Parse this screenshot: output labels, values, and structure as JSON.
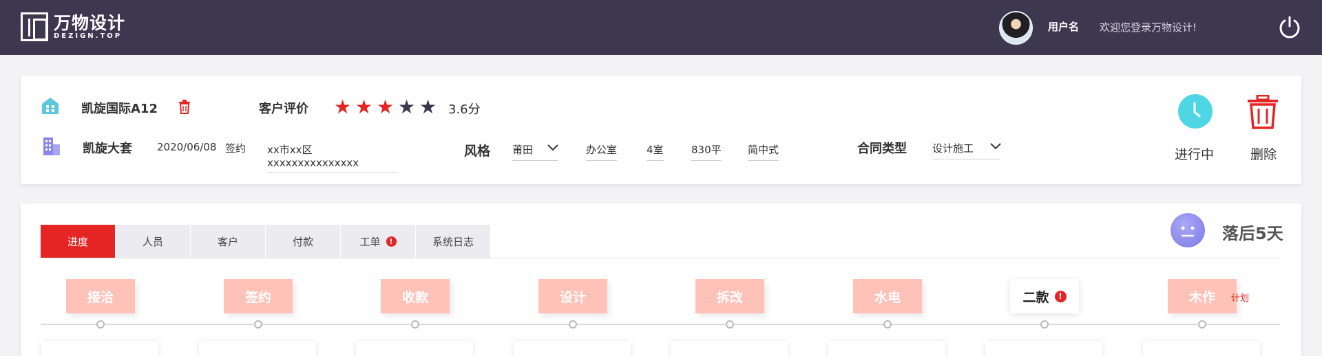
{
  "header": {
    "logo_cn": "万物设计",
    "logo_en": "DEZIGN.TOP",
    "username": "用户名",
    "welcome": "欢迎您登录万物设计!",
    "power_icon": "power-icon"
  },
  "project": {
    "name": "凯旋国际A12",
    "rating_label": "客户评价",
    "rating_value": 3.6,
    "rating_text": "3.6分",
    "rating_stars_filled": 3,
    "rating_stars_total": 5,
    "suite_name": "凯旋大套",
    "date": "2020/06/08",
    "sign_label": "签约",
    "address": "xx市xx区xxxxxxxxxxxxxxx",
    "style_label": "风格",
    "style_select": "莆田",
    "room_type": "办公室",
    "rooms": "4室",
    "area": "830平",
    "decor_style": "简中式",
    "contract_label": "合同类型",
    "contract_select": "设计施工",
    "status_label": "进行中",
    "delete_label": "删除"
  },
  "tabs": [
    {
      "label": "进度",
      "active": true
    },
    {
      "label": "人员",
      "active": false
    },
    {
      "label": "客户",
      "active": false
    },
    {
      "label": "付款",
      "active": false
    },
    {
      "label": "工单",
      "active": false,
      "alert": true
    },
    {
      "label": "系统日志",
      "active": false
    }
  ],
  "progress": {
    "behind_text": "落后5天",
    "plan_tag": "计划",
    "stages": [
      {
        "label": "接洽"
      },
      {
        "label": "签约"
      },
      {
        "label": "收款"
      },
      {
        "label": "设计"
      },
      {
        "label": "拆改"
      },
      {
        "label": "水电"
      },
      {
        "label": "二款",
        "current": true,
        "alert": true
      },
      {
        "label": "木作"
      }
    ]
  },
  "colors": {
    "header_bg": "#3d3750",
    "accent_red": "#e52424",
    "stage_pink": "#ffc2b8",
    "status_cyan": "#4fd6e4",
    "face_purple": "#8a87ee",
    "star_dark": "#3d3750"
  }
}
